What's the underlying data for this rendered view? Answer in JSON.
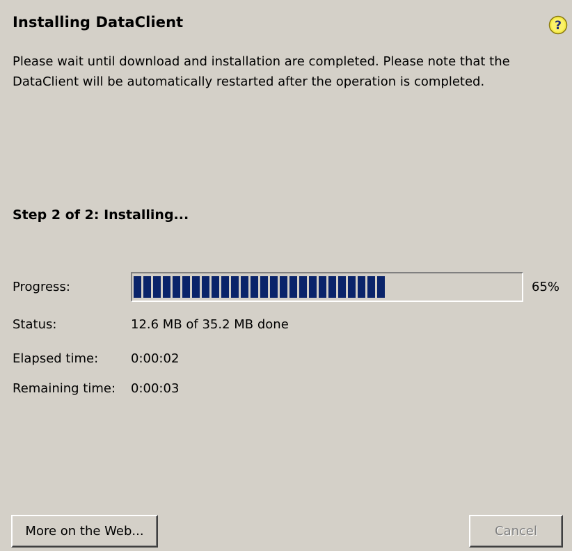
{
  "dialog": {
    "title": "Installing DataClient",
    "description": "Please wait until download and installation are completed. Please note that the DataClient will be automatically restarted after the operation is completed.",
    "step": "Step 2 of 2: Installing...",
    "icons": {
      "help": "help-question-icon"
    }
  },
  "progress": {
    "label": "Progress:",
    "value": 65,
    "percent_text": "65%",
    "bar_color": "#0a246a"
  },
  "status": {
    "label": "Status:",
    "value": "12.6 MB of 35.2 MB done"
  },
  "elapsed": {
    "label": "Elapsed time:",
    "value": "0:00:02"
  },
  "remaining": {
    "label": "Remaining time:",
    "value": "0:00:03"
  },
  "buttons": {
    "web": "More on the Web...",
    "cancel": "Cancel"
  }
}
